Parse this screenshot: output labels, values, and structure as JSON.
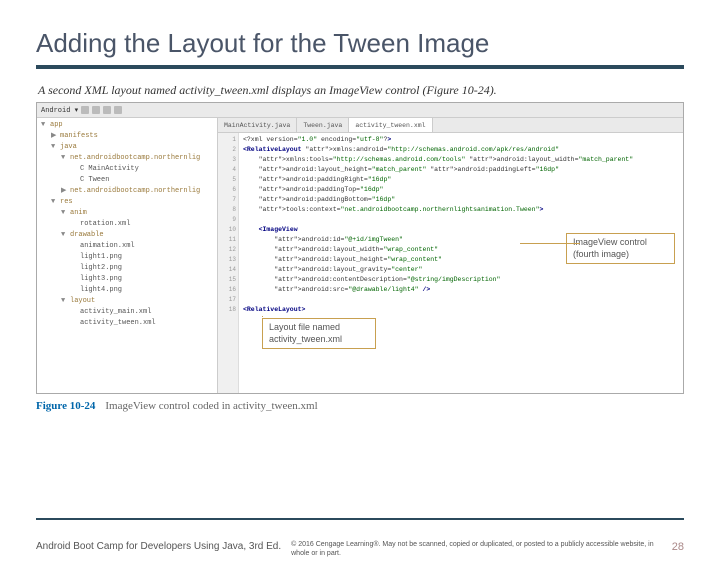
{
  "title": "Adding the Layout for the Tween Image",
  "intro": "A second XML layout named activity_tween.xml displays an ImageView control (Figure 10-24).",
  "ide": {
    "toolbar_label": "Android ▾",
    "tree": [
      {
        "ind": 0,
        "arr": "▼",
        "ic": "folder",
        "t": "app"
      },
      {
        "ind": 1,
        "arr": "▶",
        "ic": "folder",
        "t": "manifests"
      },
      {
        "ind": 1,
        "arr": "▼",
        "ic": "folder",
        "t": "java"
      },
      {
        "ind": 2,
        "arr": "▼",
        "ic": "folder",
        "t": "net.androidbootcamp.northernlig"
      },
      {
        "ind": 3,
        "arr": "",
        "ic": "file",
        "t": "C  MainActivity"
      },
      {
        "ind": 3,
        "arr": "",
        "ic": "file",
        "t": "C  Tween"
      },
      {
        "ind": 2,
        "arr": "▶",
        "ic": "folder",
        "t": "net.androidbootcamp.northernlig"
      },
      {
        "ind": 1,
        "arr": "▼",
        "ic": "folder",
        "t": "res"
      },
      {
        "ind": 2,
        "arr": "▼",
        "ic": "folder",
        "t": "anim"
      },
      {
        "ind": 3,
        "arr": "",
        "ic": "file",
        "t": "rotation.xml"
      },
      {
        "ind": 2,
        "arr": "▼",
        "ic": "folder",
        "t": "drawable"
      },
      {
        "ind": 3,
        "arr": "",
        "ic": "file",
        "t": "animation.xml"
      },
      {
        "ind": 3,
        "arr": "",
        "ic": "file",
        "t": "light1.png"
      },
      {
        "ind": 3,
        "arr": "",
        "ic": "file",
        "t": "light2.png"
      },
      {
        "ind": 3,
        "arr": "",
        "ic": "file",
        "t": "light3.png"
      },
      {
        "ind": 3,
        "arr": "",
        "ic": "file",
        "t": "light4.png"
      },
      {
        "ind": 2,
        "arr": "▼",
        "ic": "folder",
        "t": "layout"
      },
      {
        "ind": 3,
        "arr": "",
        "ic": "file",
        "t": "activity_main.xml"
      },
      {
        "ind": 3,
        "arr": "",
        "ic": "file",
        "t": "activity_tween.xml"
      }
    ],
    "tabs": [
      {
        "label": "MainActivity.java",
        "active": false
      },
      {
        "label": "Tween.java",
        "active": false
      },
      {
        "label": "activity_tween.xml",
        "active": true
      }
    ],
    "code": [
      "<?xml version=\"1.0\" encoding=\"utf-8\"?>",
      "<RelativeLayout xmlns:android=\"http://schemas.android.com/apk/res/android\"",
      "    xmlns:tools=\"http://schemas.android.com/tools\" android:layout_width=\"match_parent\"",
      "    android:layout_height=\"match_parent\" android:paddingLeft=\"16dp\"",
      "    android:paddingRight=\"16dp\"",
      "    android:paddingTop=\"16dp\"",
      "    android:paddingBottom=\"16dp\"",
      "    tools:context=\"net.androidbootcamp.northernlightsanimation.Tween\">",
      "",
      "    <ImageView",
      "        android:id=\"@+id/imgTween\"",
      "        android:layout_width=\"wrap_content\"",
      "        android:layout_height=\"wrap_content\"",
      "        android:layout_gravity=\"center\"",
      "        android:contentDescription=\"@string/imgDescription\"",
      "        android:src=\"@drawable/light4\" />",
      "",
      "</RelativeLayout>"
    ]
  },
  "callouts": [
    {
      "l1": "ImageView control",
      "l2": "(fourth image)"
    },
    {
      "l1": "Layout file named",
      "l2": "activity_tween.xml"
    }
  ],
  "figure": {
    "num": "Figure 10-24",
    "text": "ImageView control coded in activity_tween.xml"
  },
  "footer": {
    "book": "Android Boot Camp for Developers Using Java, 3rd Ed.",
    "copyright": "© 2016 Cengage Learning®. May not be scanned, copied or duplicated, or posted to a publicly accessible website, in whole or in part.",
    "page": "28"
  }
}
